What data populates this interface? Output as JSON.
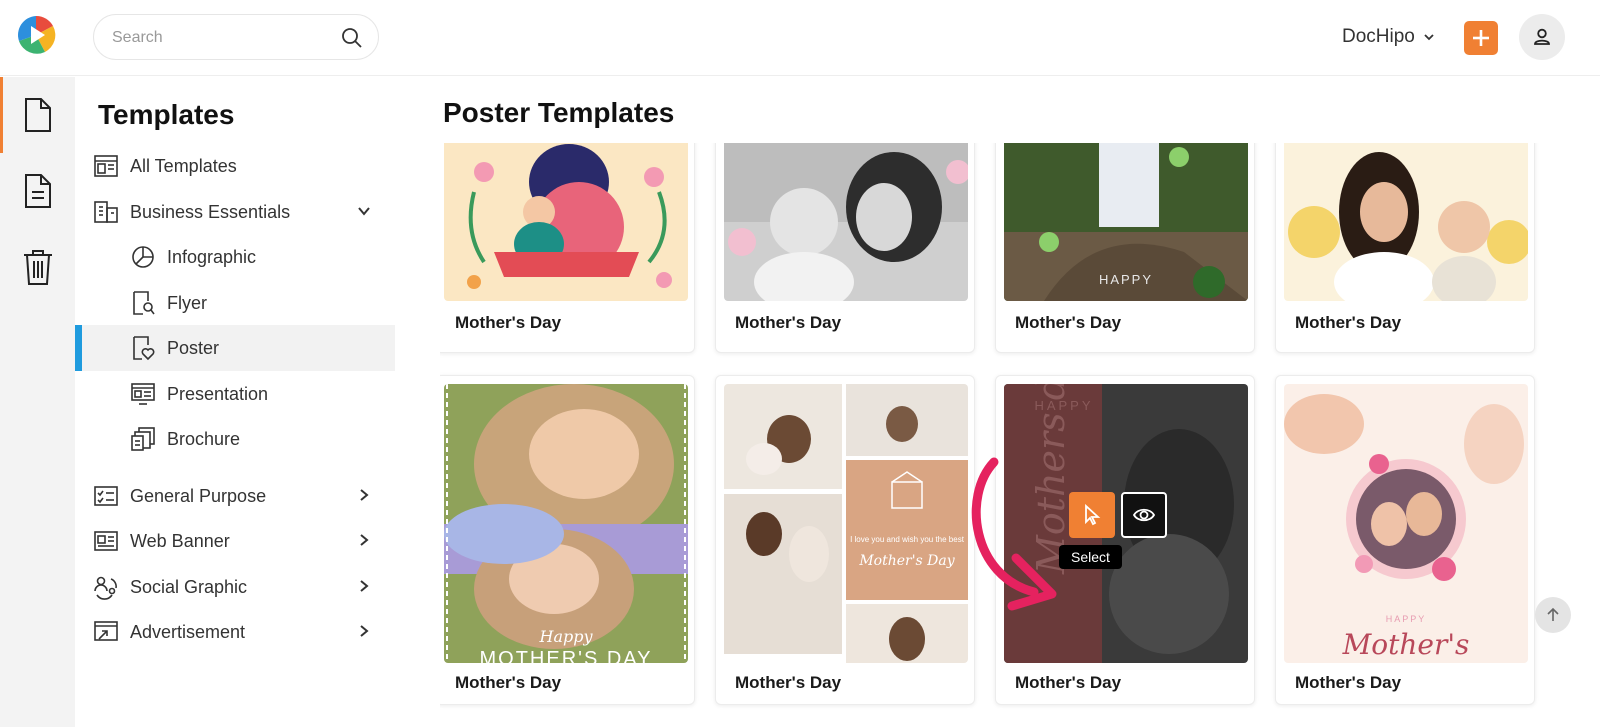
{
  "header": {
    "search_placeholder": "Search",
    "account_name": "DocHipo"
  },
  "rail": {
    "items": [
      {
        "icon": "document-icon",
        "active": true
      },
      {
        "icon": "list-document-icon",
        "active": false
      },
      {
        "icon": "trash-icon",
        "active": false
      }
    ]
  },
  "sidebar": {
    "title": "Templates",
    "items": [
      {
        "label": "All Templates",
        "icon": "all-templates-icon"
      },
      {
        "label": "Business Essentials",
        "icon": "building-icon",
        "expanded": true
      },
      {
        "label": "Infographic",
        "icon": "pie-chart-icon"
      },
      {
        "label": "Flyer",
        "icon": "flyer-icon"
      },
      {
        "label": "Poster",
        "icon": "poster-heart-icon",
        "active": true
      },
      {
        "label": "Presentation",
        "icon": "presentation-icon"
      },
      {
        "label": "Brochure",
        "icon": "brochure-icon"
      },
      {
        "label": "General Purpose",
        "icon": "checklist-icon"
      },
      {
        "label": "Web Banner",
        "icon": "web-banner-icon"
      },
      {
        "label": "Social Graphic",
        "icon": "social-graphic-icon"
      },
      {
        "label": "Advertisement",
        "icon": "advertisement-icon"
      }
    ]
  },
  "main": {
    "title": "Poster Templates",
    "cards": [
      {
        "caption": "Mother's Day"
      },
      {
        "caption": "Mother's Day"
      },
      {
        "caption": "Mother's Day",
        "thumb_text": "HAPPY"
      },
      {
        "caption": "Mother's Day"
      },
      {
        "caption": "Mother's Day",
        "thumb_text": "Happy",
        "thumb_text2": "MOTHER'S DAY"
      },
      {
        "caption": "Mother's Day",
        "thumb_text": "I love you and wish you the best",
        "thumb_text2": "Mother's Day"
      },
      {
        "caption": "Mother's Day",
        "thumb_text": "HAPPY"
      },
      {
        "caption": "Mother's Day",
        "thumb_text": "HAPPY",
        "thumb_text2": "Mother's"
      }
    ],
    "hover_tooltip": "Select"
  },
  "colors": {
    "accent": "#f08033",
    "active_indicator": "#1f9bde",
    "callout_arrow": "#e5225f"
  }
}
